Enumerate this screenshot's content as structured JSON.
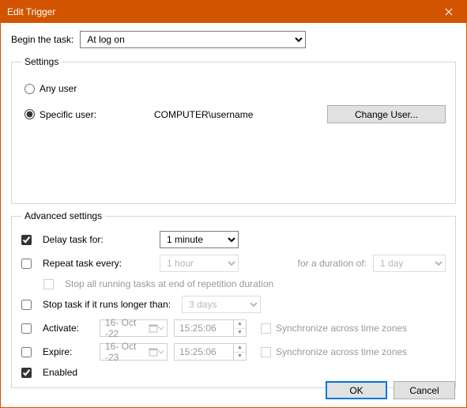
{
  "window": {
    "title": "Edit Trigger"
  },
  "begin": {
    "label": "Begin the task:",
    "value": "At log on"
  },
  "settings": {
    "legend": "Settings",
    "any_user_label": "Any user",
    "specific_user_label": "Specific user:",
    "selected": "specific",
    "user_display": "COMPUTER\\username",
    "change_user_btn": "Change User..."
  },
  "advanced": {
    "legend": "Advanced settings",
    "delay": {
      "label": "Delay task for:",
      "checked": true,
      "value": "1 minute"
    },
    "repeat": {
      "label": "Repeat task every:",
      "checked": false,
      "value": "1 hour",
      "duration_label": "for a duration of:",
      "duration_value": "1 day"
    },
    "stop_all_label": "Stop all running tasks at end of repetition duration",
    "stop_if": {
      "label": "Stop task if it runs longer than:",
      "checked": false,
      "value": "3 days"
    },
    "activate": {
      "label": "Activate:",
      "checked": false,
      "date": "16- Oct -22",
      "time": "15:25:06",
      "sync_label": "Synchronize across time zones"
    },
    "expire": {
      "label": "Expire:",
      "checked": false,
      "date": "16- Oct -23",
      "time": "15:25:06",
      "sync_label": "Synchronize across time zones"
    },
    "enabled": {
      "label": "Enabled",
      "checked": true
    }
  },
  "buttons": {
    "ok": "OK",
    "cancel": "Cancel"
  }
}
